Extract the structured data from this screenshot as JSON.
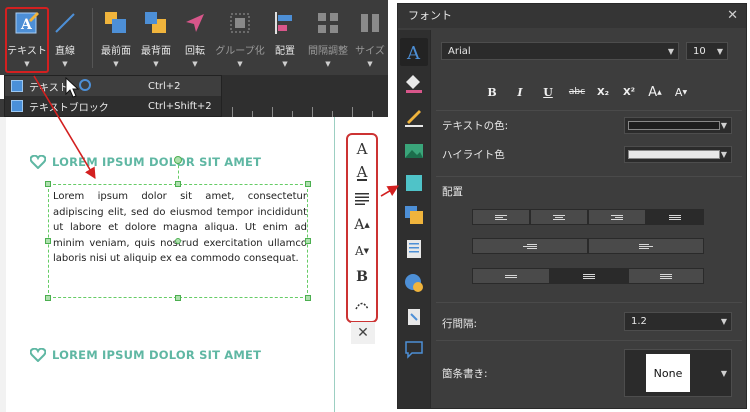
{
  "toolbar": {
    "buttons": [
      {
        "label": "テキスト",
        "icon": "text-tool-icon"
      },
      {
        "label": "直線",
        "icon": "line-tool-icon"
      },
      {
        "label": "最前面",
        "icon": "bring-to-front-icon"
      },
      {
        "label": "最背面",
        "icon": "send-to-back-icon"
      },
      {
        "label": "回転",
        "icon": "rotate-icon"
      },
      {
        "label": "グループ化",
        "icon": "group-icon"
      },
      {
        "label": "配置",
        "icon": "align-icon"
      },
      {
        "label": "間隔調整",
        "icon": "distribute-icon"
      },
      {
        "label": "サイズ",
        "icon": "size-icon"
      }
    ]
  },
  "dropdown": {
    "items": [
      {
        "label": "テキスト",
        "shortcut": "Ctrl+2"
      },
      {
        "label": "テキストブロック",
        "shortcut": "Ctrl+Shift+2"
      }
    ]
  },
  "canvas": {
    "heading1": "LOREM IPSUM DOLOR SIT AMET",
    "heading2": "LOREM IPSUM DOLOR SIT AMET",
    "body": "Lorem ipsum dolor sit amet, consectetur adipiscing elit, sed do eiusmod tempor incididunt ut labore et dolore magna aliqua. Ut enim ad minim veniam, quis nostrud exercitation ullamco laboris nisi ut aliquip ex ea commodo consequat."
  },
  "mini_toolbar": {
    "font_glyph": "A",
    "bold_glyph": "B",
    "close_glyph": "✕"
  },
  "panel": {
    "title": "フォント",
    "close": "✕",
    "font_name": "Arial",
    "font_size": "10",
    "format_buttons": [
      "B",
      "I",
      "U",
      "abc",
      "X₂",
      "X²",
      "A",
      "A"
    ],
    "text_color_label": "テキストの色:",
    "highlight_label": "ハイライト色",
    "alignment_label": "配置",
    "line_spacing_label": "行間隔:",
    "line_spacing_value": "1.2",
    "bullets_label": "箇条書き:",
    "bullets_value": "None"
  },
  "colors": {
    "accent": "#5fb7a3",
    "highlight_red": "#cc3333",
    "panel_bg": "#3d3d3d",
    "toolbar_bg": "#3c3c3c",
    "text_color_swatch": "#1e1e1e",
    "highlight_swatch": "#e8e8e8"
  }
}
